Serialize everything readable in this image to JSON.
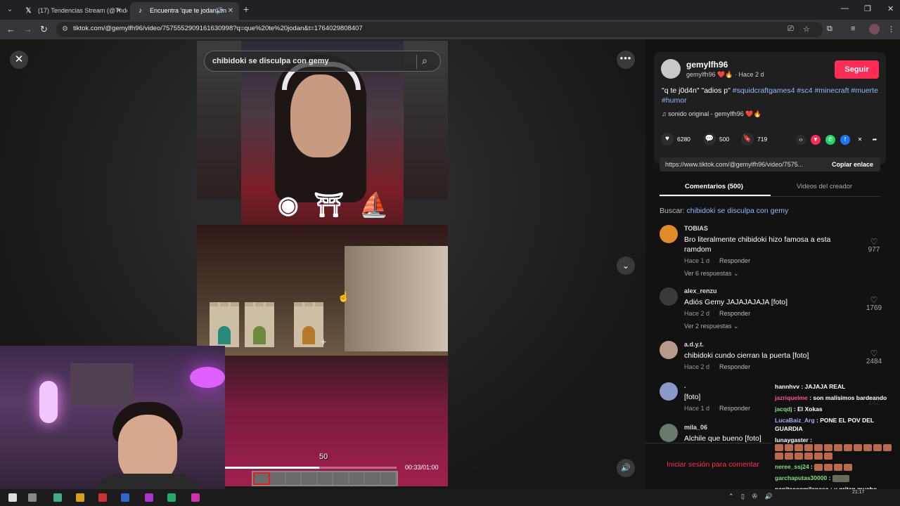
{
  "browser": {
    "tabs": [
      {
        "icon": "x-icon",
        "title": "(17) Tendencias Stream (@Tnde"
      },
      {
        "icon": "tiktok-icon",
        "title": "Encuentra 'que te jodan' en"
      }
    ],
    "url": "tiktok.com/@gemylfh96/video/7575552909161630998?q=que%20te%20jodan&t=1764029808407"
  },
  "video": {
    "search_query": "chibidoki se disculpa con gemy",
    "hud_count": "50",
    "time": "00:33/01:00",
    "progress": 0.55,
    "logos": "◉ ⛩ ⛵"
  },
  "post": {
    "username": "gemylfh96",
    "subline": "gemylfh96 ❤️🔥 · Hace 2 d",
    "follow_label": "Seguir",
    "desc_text": "\"q te j0d4n\" \"adios p\"",
    "hashtags": "#squidcraftgames4 #sc4 #minecraft #muerte #humor",
    "sound": "♫  sonido original - gemylfh96 ❤️🔥",
    "likes": "6280",
    "comments": "500",
    "saves": "719",
    "link": "https://www.tiktok.com/@gemylfh96/video/7575...",
    "copy_label": "Copiar enlace"
  },
  "tabs": {
    "comments": "Comentarios (500)",
    "creator_videos": "Videos del creador"
  },
  "search": {
    "label": "Buscar:",
    "query": "chibidoki se disculpa con gemy"
  },
  "comments": [
    {
      "user": "TOBIAS",
      "text": "Bro literalmente chibidoki hizo famosa a esta ramdom",
      "time": "Hace 1 d",
      "reply": "Responder",
      "replies": "Ver 6 respuestas ⌄",
      "likes": "977",
      "color": "#e08a2a"
    },
    {
      "user": "alex_renzu",
      "text": "Adiós Gemy JAJAJAJAJA [foto]",
      "time": "Hace 2 d",
      "reply": "Responder",
      "replies": "Ver 2 respuestas ⌄",
      "likes": "1769",
      "color": "#3a3a3a"
    },
    {
      "user": "a.d.y.t.",
      "text": "chibidoki cundo cierran la puerta [foto]",
      "time": "Hace 2 d",
      "reply": "Responder",
      "replies": "",
      "likes": "2484",
      "color": "#b89a8a"
    },
    {
      "user": ".",
      "text": "[foto]",
      "time": "Hace 1 d",
      "reply": "Responder",
      "replies": "",
      "likes": "142",
      "color": "#8a9ac8"
    },
    {
      "user": "mila_06",
      "text": "Alchile que bueno [foto]",
      "time": "",
      "reply": "",
      "replies": "",
      "likes": "",
      "color": "#6a7a6a"
    }
  ],
  "login_prompt": "Iniciar sesión para comentar",
  "chat": [
    {
      "user": "hannhvv",
      "color": "#ffffff",
      "text": "JAJAJA REAL"
    },
    {
      "user": "jazriquelme",
      "color": "#ff4fa0",
      "text": "son malísimos bardeando"
    },
    {
      "user": "jacqdj",
      "color": "#7fe07f",
      "text": "El Xokas"
    },
    {
      "user": "LucaBaiz_Arg",
      "color": "#9fb0ff",
      "text": "PONE EL POV DEL GUARDIA"
    },
    {
      "user": "lunaygaster",
      "color": "#ffffff",
      "text": ""
    },
    {
      "user": "neree_ssj24",
      "color": "#7fe07f",
      "text": ""
    },
    {
      "user": "garchaputas30000",
      "color": "#7fe07f",
      "text": ""
    },
    {
      "user": "papitaconmilanesa",
      "color": "#ffffff",
      "text": "y gritan mucho"
    }
  ],
  "taskbar": {
    "time": "21:17"
  }
}
